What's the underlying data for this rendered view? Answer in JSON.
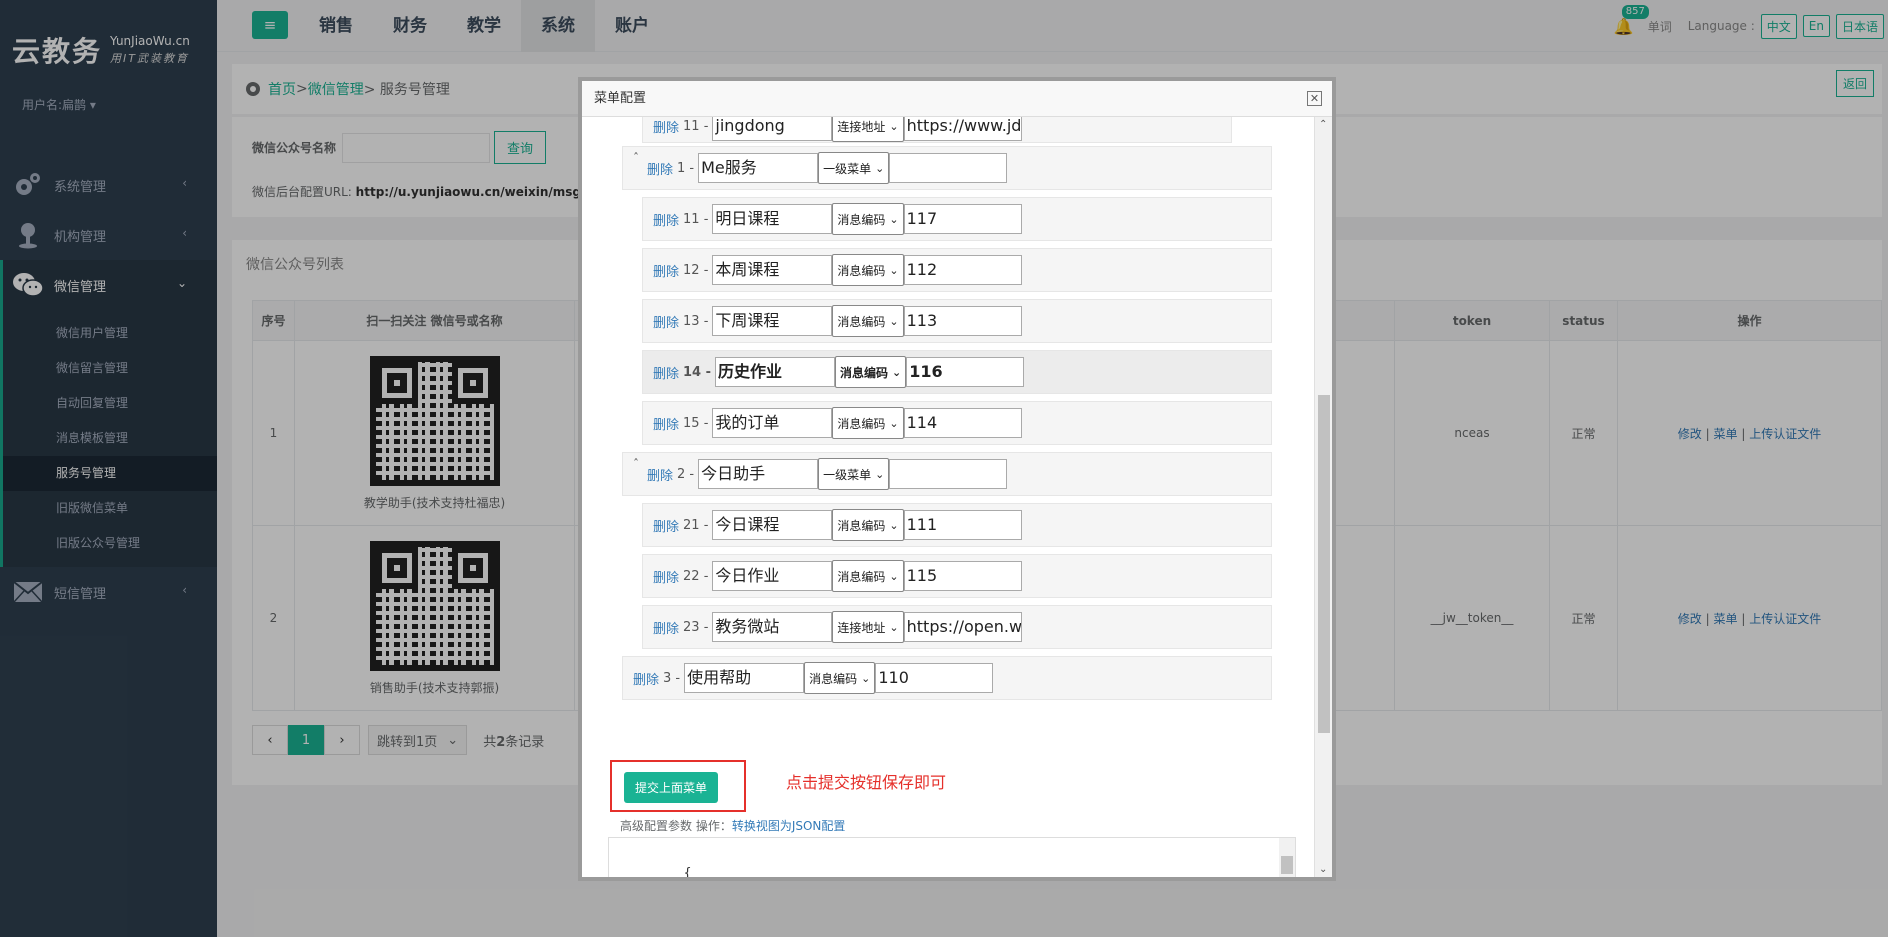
{
  "sidebar": {
    "logo_main": "云教务",
    "logo_sub": "YunJiaoWu.cn",
    "logo_sub2": "用IT武装教育",
    "user": "用户名:扁鹊 ▾",
    "items": [
      {
        "label": "系统管理",
        "icon": "gears-icon"
      },
      {
        "label": "机构管理",
        "icon": "map-marker-icon"
      },
      {
        "label": "微信管理",
        "icon": "wechat-icon"
      },
      {
        "label": "短信管理",
        "icon": "envelope-icon"
      }
    ],
    "wechat_sub": [
      "微信用户管理",
      "微信留言管理",
      "自动回复管理",
      "消息模板管理",
      "服务号管理",
      "旧版微信菜单",
      "旧版公众号管理"
    ]
  },
  "topbar": {
    "toggle": "≡",
    "tabs": [
      "销售",
      "财务",
      "教学",
      "系统",
      "账户"
    ],
    "active_tab": "系统",
    "badge": "857",
    "word": "单词",
    "language_label": "Language :",
    "langs": [
      "中文",
      "En",
      "日本语"
    ]
  },
  "breadcrumb": {
    "home": "首页",
    "sep1": " >",
    "mid": "微信管理",
    "sep2": " > 服务号管理",
    "back": "返回"
  },
  "search": {
    "label": "微信公众号名称",
    "button": "查询",
    "url_label": "微信后台配置URL: ",
    "url": "http://u.yunjiaowu.cn/weixin/msg?app"
  },
  "list": {
    "title": "微信公众号列表",
    "headers": [
      "序号",
      "扫一扫关注 微信号或名称",
      "token",
      "status",
      "操作"
    ],
    "rows": [
      {
        "no": "1",
        "name": "教学助手(技术支持杜福忠)",
        "token": "nceas",
        "status": "正常"
      },
      {
        "no": "2",
        "name": "销售助手(技术支持郭振)",
        "token": "__jw__token__",
        "status": "正常"
      }
    ],
    "ops": [
      "修改",
      "菜单",
      "上传认证文件"
    ],
    "op_sep": "|",
    "pager_prev": "‹",
    "pager_page": "1",
    "pager_next": "›",
    "jump": "跳转到1页",
    "jump_arrow": "⌄",
    "total_prefix": "共",
    "total_count": "2",
    "total_suffix": "条记录"
  },
  "modal": {
    "title": "菜单配置",
    "close": "✕",
    "del": "删除",
    "collapse": "ˆ",
    "scroll_up": "⌃",
    "scroll_down": "⌄",
    "rows": [
      {
        "num": "11 -",
        "name": "jingdong",
        "type": "连接地址",
        "value": "https://www.jd.c"
      },
      {
        "num": "1 -",
        "name": "Me服务",
        "type": "一级菜单",
        "value": ""
      },
      {
        "num": "11 -",
        "name": "明日课程",
        "type": "消息编码",
        "value": "117"
      },
      {
        "num": "12 -",
        "name": "本周课程",
        "type": "消息编码",
        "value": "112"
      },
      {
        "num": "13 -",
        "name": "下周课程",
        "type": "消息编码",
        "value": "113"
      },
      {
        "num": "14 -",
        "name": "历史作业",
        "type": "消息编码",
        "value": "116"
      },
      {
        "num": "15 -",
        "name": "我的订单",
        "type": "消息编码",
        "value": "114"
      },
      {
        "num": "2 -",
        "name": "今日助手",
        "type": "一级菜单",
        "value": ""
      },
      {
        "num": "21 -",
        "name": "今日课程",
        "type": "消息编码",
        "value": "111"
      },
      {
        "num": "22 -",
        "name": "今日作业",
        "type": "消息编码",
        "value": "115"
      },
      {
        "num": "23 -",
        "name": "教务微站",
        "type": "连接地址",
        "value": "https://open.we"
      },
      {
        "num": "3 -",
        "name": "使用帮助",
        "type": "消息编码",
        "value": "110"
      }
    ],
    "submit": "提交上面菜单",
    "tip": "点击提交按钮保存即可",
    "adv_label": "高级配置参数 操作：",
    "adv_link": "转换视图为JSON配置",
    "json": "{\n   \"button\": [\n      {\n         \"name\": \"Me服务\","
  }
}
